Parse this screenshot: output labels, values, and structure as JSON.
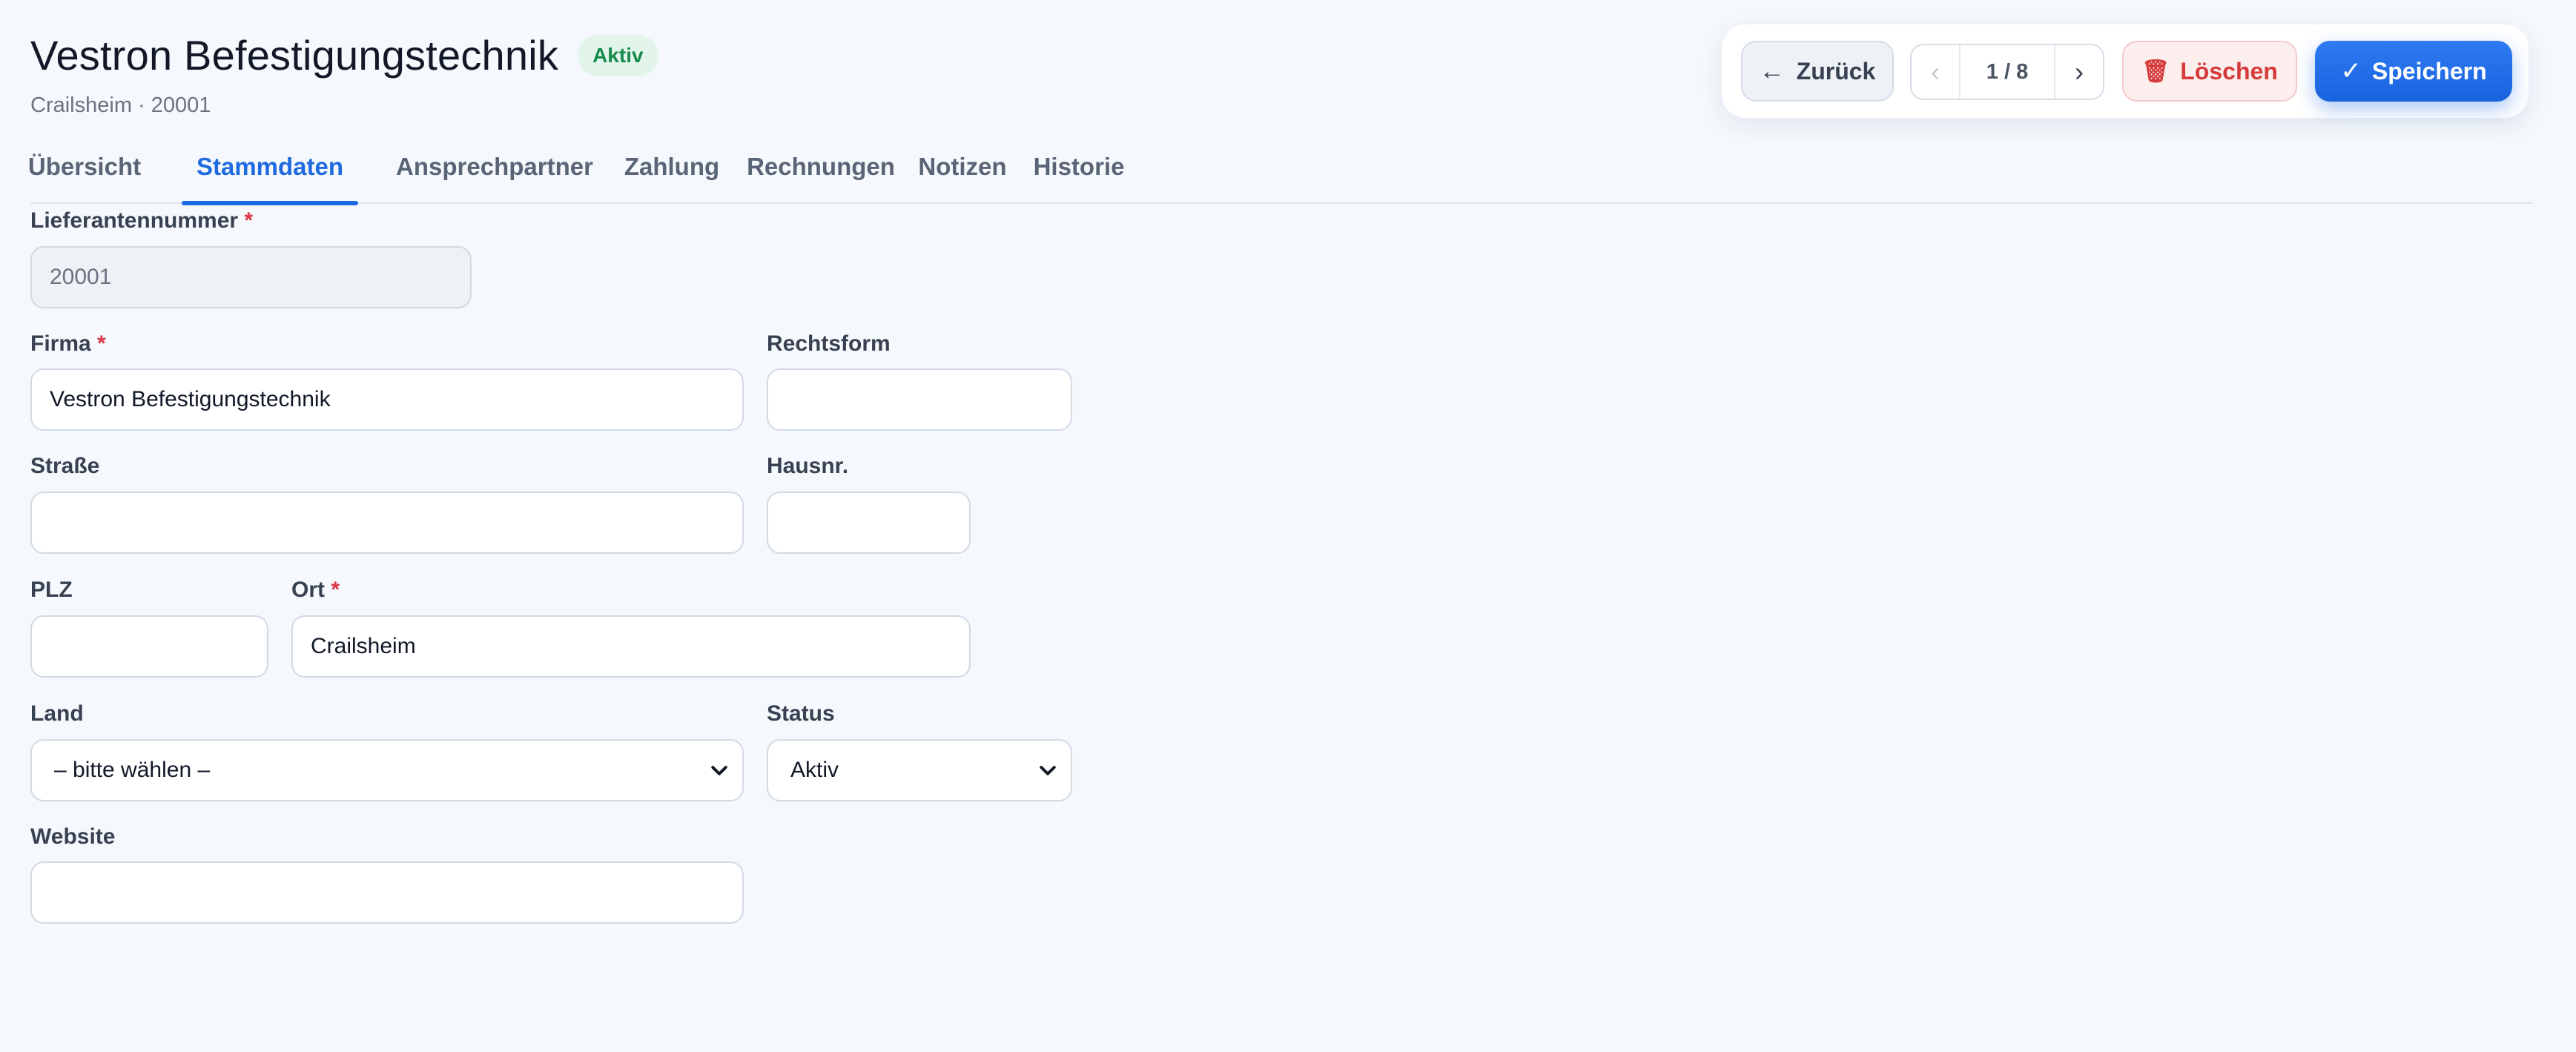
{
  "header": {
    "title": "Vestron Befestigungstechnik",
    "status_badge": "Aktiv",
    "subtitle": "Crailsheim · 20001"
  },
  "toolbar": {
    "back_arrow": "←",
    "back_label": "Zurück",
    "pager_prev": "‹",
    "pager_count": "1 / 8",
    "pager_next": "›",
    "delete_icon": "🗑",
    "delete_label": "Löschen",
    "save_icon": "✓",
    "save_label": "Speichern"
  },
  "tabs": [
    {
      "label": "Übersicht",
      "active": false
    },
    {
      "label": "Stammdaten",
      "active": true
    },
    {
      "label": "Ansprechpartner",
      "active": false
    },
    {
      "label": "Zahlung",
      "active": false
    },
    {
      "label": "Rechnungen",
      "active": false
    },
    {
      "label": "Notizen",
      "active": false
    },
    {
      "label": "Historie",
      "active": false
    }
  ],
  "form": {
    "required_marker": "*",
    "supplier_number": {
      "label": "Lieferantennummer",
      "value": "20001",
      "required": true
    },
    "company": {
      "label": "Firma",
      "value": "Vestron Befestigungstechnik",
      "required": true
    },
    "legal_form": {
      "label": "Rechtsform",
      "value": ""
    },
    "street": {
      "label": "Straße",
      "value": ""
    },
    "house_number": {
      "label": "Hausnr.",
      "value": ""
    },
    "zip": {
      "label": "PLZ",
      "value": ""
    },
    "city": {
      "label": "Ort",
      "value": "Crailsheim",
      "required": true
    },
    "country": {
      "label": "Land",
      "selected": "– bitte wählen –"
    },
    "status": {
      "label": "Status",
      "selected": "Aktiv"
    },
    "website": {
      "label": "Website",
      "value": ""
    }
  },
  "colors": {
    "accent": "#1e6ae0",
    "badge_bg": "#e3f5ea",
    "badge_text": "#178a4c",
    "danger": "#d63a3a",
    "required": "#dc3545"
  }
}
